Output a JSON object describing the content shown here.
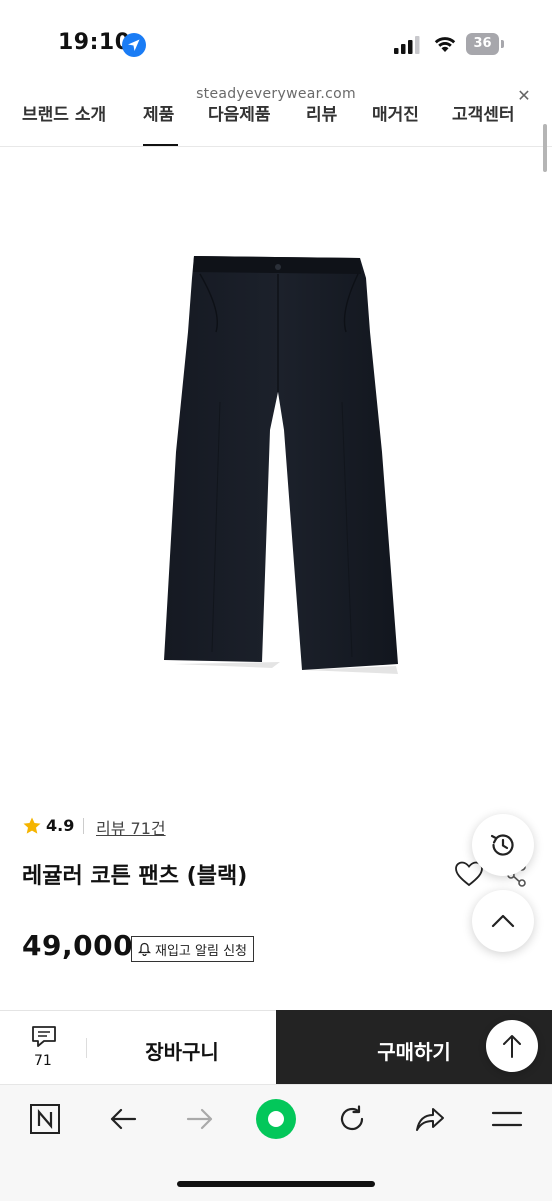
{
  "status_bar": {
    "time": "19:10",
    "battery": "36",
    "location_icon": "location-arrow-icon",
    "signal_icon": "cellular-signal-icon",
    "wifi_icon": "wifi-icon"
  },
  "browser": {
    "url": "steadyeverywear.com",
    "close_icon": "close-icon"
  },
  "category_nav": {
    "items": [
      "브랜드 소개",
      "제품",
      "다음제품",
      "리뷰",
      "매거진",
      "고객센터"
    ],
    "active_index": 1
  },
  "product": {
    "image_alt": "black-pants-image",
    "rating": "4.9",
    "review_link": "리뷰 71건",
    "name": "레귤러 코튼 팬츠 (블랙)",
    "price": "49,000",
    "restock_label": "재입고 알림 신청"
  },
  "purchase_bar": {
    "comment_count": "71",
    "cart_label": "장바구니",
    "buy_label": "구매하기"
  },
  "colors": {
    "accent_star": "#f5b400",
    "buy_button_bg": "#232323",
    "naver_green": "#03c75a"
  }
}
